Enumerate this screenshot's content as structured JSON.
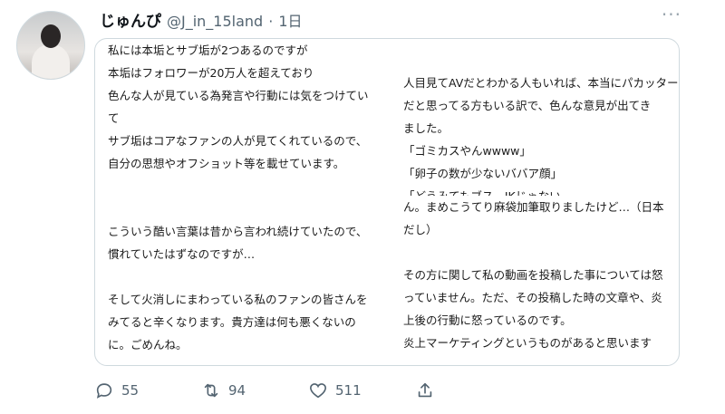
{
  "tweet": {
    "author_name": "じゅんぴ",
    "author_handle": "@J_in_15land",
    "separator": "·",
    "age": "1日",
    "more_icon": "more-icon"
  },
  "image_text": {
    "left": [
      "私には本垢とサブ垢が2つあるのですが",
      "本垢はフォロワーが20万人を超えており",
      "色んな人が見ている為発言や行動には気をつけてい",
      "て",
      "サブ垢はコアなファンの人が見てくれているので、",
      "自分の思想やオフショット等を載せています。",
      "",
      "",
      "こういう酷い言葉は昔から言われ続けていたので、",
      "慣れていたはずなのですが…",
      "",
      "そして火消しにまわっている私のファンの皆さんを",
      "みてると辛くなります。貴方達は何も悪くないの",
      "に。ごめんね。"
    ],
    "right_top": [
      "人目見てAVだとわかる人もいれば、本当にパカッター",
      "だと思ってる方もいる訳で、色んな意見が出てき",
      "ました。",
      "「ゴミカスやんwwww」",
      "「卵子の数が少ないババア顔」"
    ],
    "right_cut": "「どうみてもブス　JKじゃない",
    "right_bottom": [
      "ん。まめこうてり麻袋加筆取りましたけど…（日本",
      "だし）",
      "",
      "その方に関して私の動画を投稿した事については怒",
      "っていません。ただ、その投稿した時の文章や、炎",
      "上後の行動に怒っているのです。",
      "炎上マーケティングというものがあると思います"
    ]
  },
  "actions": {
    "replies": "55",
    "retweets": "94",
    "likes": "511"
  }
}
